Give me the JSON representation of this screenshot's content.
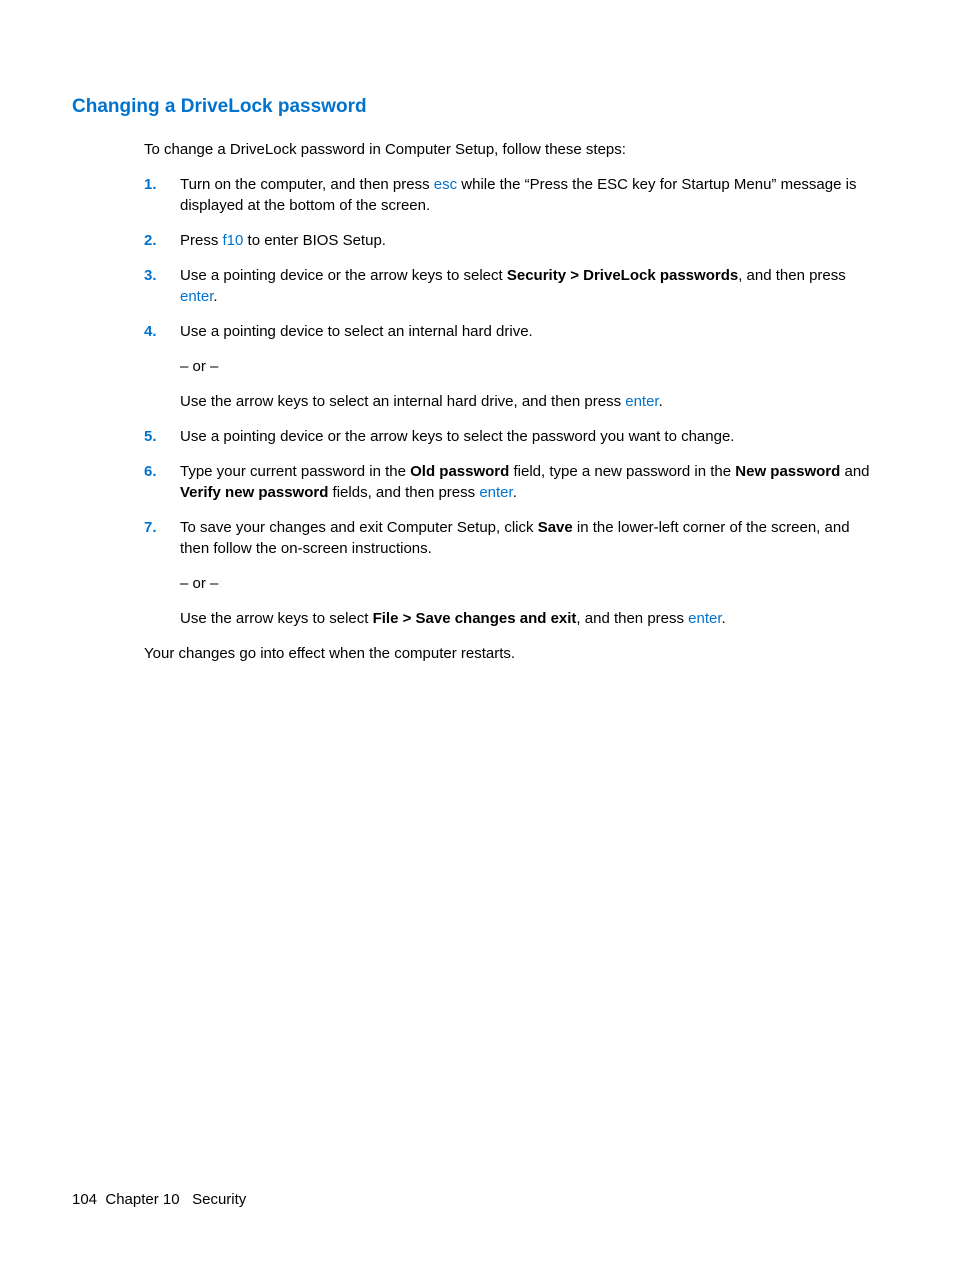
{
  "heading": "Changing a DriveLock password",
  "intro": "To change a DriveLock password in Computer Setup, follow these steps:",
  "steps": [
    {
      "num": "1.",
      "parts": [
        {
          "t": "Turn on the computer, and then press "
        },
        {
          "t": "esc",
          "key": true
        },
        {
          "t": " while the “Press the ESC key for Startup Menu” message is displayed at the bottom of the screen."
        }
      ]
    },
    {
      "num": "2.",
      "parts": [
        {
          "t": "Press "
        },
        {
          "t": "f10",
          "key": true
        },
        {
          "t": " to enter BIOS Setup."
        }
      ]
    },
    {
      "num": "3.",
      "parts": [
        {
          "t": "Use a pointing device or the arrow keys to select "
        },
        {
          "t": "Security > DriveLock passwords",
          "bold": true
        },
        {
          "t": ", and then press "
        },
        {
          "t": "enter",
          "key": true
        },
        {
          "t": "."
        }
      ]
    },
    {
      "num": "4.",
      "paras": [
        [
          {
            "t": "Use a pointing device to select an internal hard drive."
          }
        ],
        [
          {
            "t": "– or –"
          }
        ],
        [
          {
            "t": "Use the arrow keys to select an internal hard drive, and then press "
          },
          {
            "t": "enter",
            "key": true
          },
          {
            "t": "."
          }
        ]
      ]
    },
    {
      "num": "5.",
      "parts": [
        {
          "t": "Use a pointing device or the arrow keys to select the password you want to change."
        }
      ]
    },
    {
      "num": "6.",
      "parts": [
        {
          "t": "Type your current password in the "
        },
        {
          "t": "Old password",
          "bold": true
        },
        {
          "t": " field, type a new password in the "
        },
        {
          "t": "New password",
          "bold": true
        },
        {
          "t": " and "
        },
        {
          "t": "Verify new password",
          "bold": true
        },
        {
          "t": " fields, and then press "
        },
        {
          "t": "enter",
          "key": true
        },
        {
          "t": "."
        }
      ]
    },
    {
      "num": "7.",
      "paras": [
        [
          {
            "t": "To save your changes and exit Computer Setup, click "
          },
          {
            "t": "Save",
            "bold": true
          },
          {
            "t": " in the lower-left corner of the screen, and then follow the on-screen instructions."
          }
        ],
        [
          {
            "t": "– or –"
          }
        ],
        [
          {
            "t": "Use the arrow keys to select "
          },
          {
            "t": "File > Save changes and exit",
            "bold": true
          },
          {
            "t": ", and then press "
          },
          {
            "t": "enter",
            "key": true
          },
          {
            "t": "."
          }
        ]
      ]
    }
  ],
  "closing": "Your changes go into effect when the computer restarts.",
  "footer": {
    "page": "104",
    "chapter": "Chapter 10",
    "title": "Security"
  }
}
